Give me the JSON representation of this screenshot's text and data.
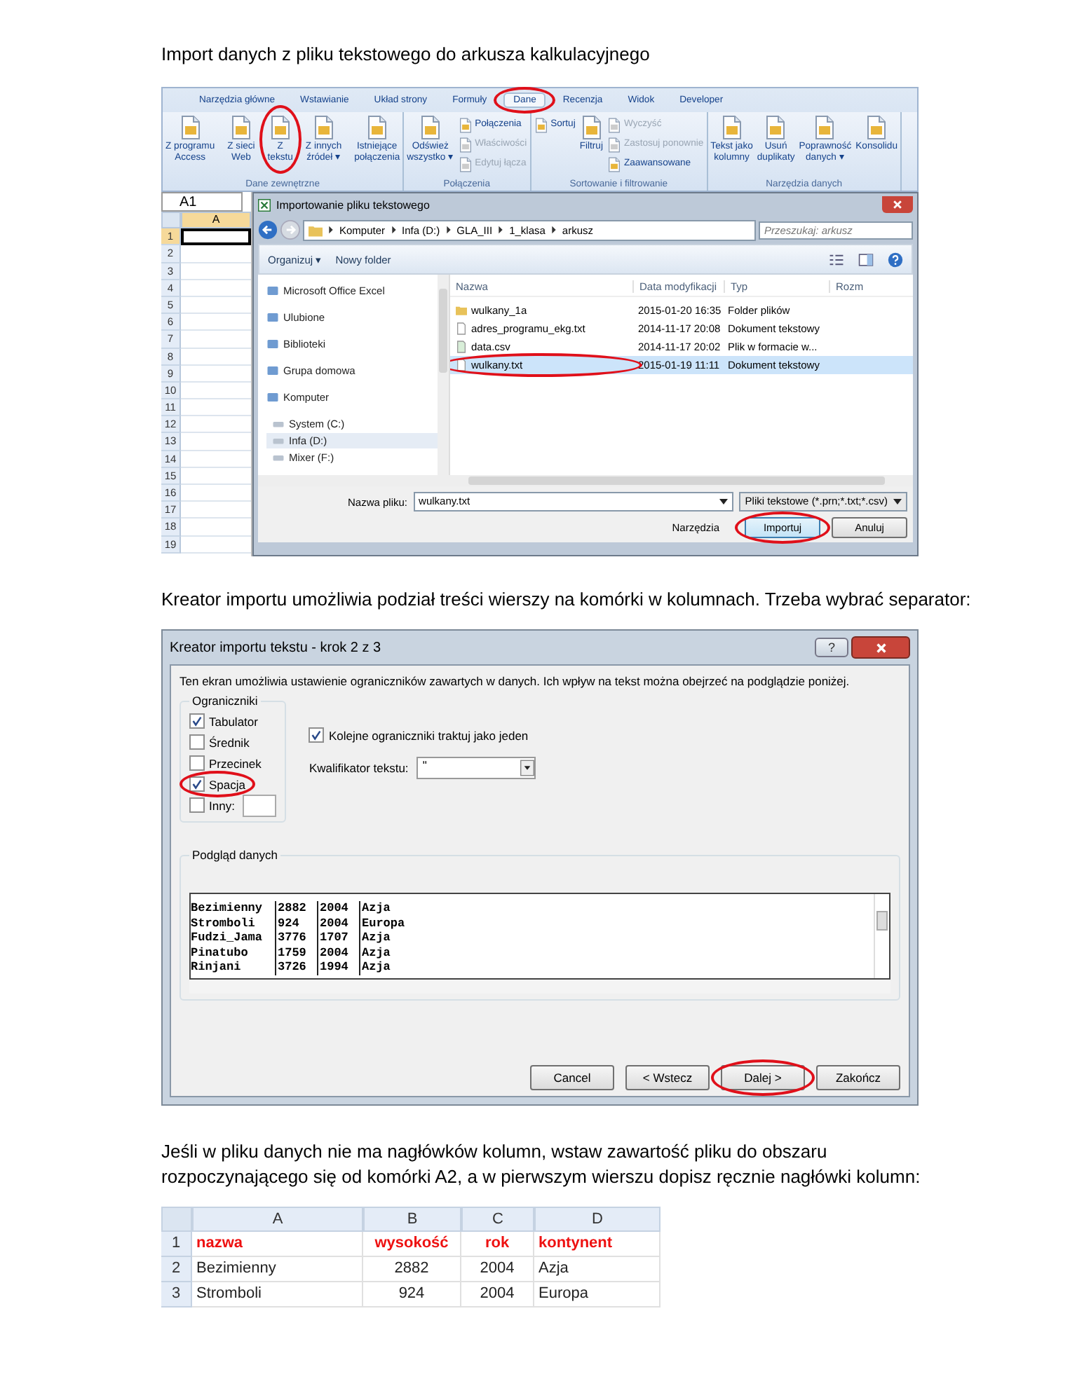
{
  "heading": "Import danych z pliku tekstowego do arkusza kalkulacyjnego",
  "excel": {
    "ribbon": {
      "tabs": [
        {
          "label": "Narzędzia główne",
          "selected": false,
          "circled": false
        },
        {
          "label": "Wstawianie",
          "selected": false,
          "circled": false
        },
        {
          "label": "Układ strony",
          "selected": false,
          "circled": false
        },
        {
          "label": "Formuły",
          "selected": false,
          "circled": false
        },
        {
          "label": "Dane",
          "selected": true,
          "circled": true
        },
        {
          "label": "Recenzja",
          "selected": false,
          "circled": false
        },
        {
          "label": "Widok",
          "selected": false,
          "circled": false
        },
        {
          "label": "Developer",
          "selected": false,
          "circled": false
        }
      ],
      "groups": [
        {
          "label": "Dane zewnętrzne",
          "items": [
            {
              "kind": "large",
              "label": "Z programu\nAccess",
              "disabled": false,
              "circled": false
            },
            {
              "kind": "large",
              "label": "Z sieci\nWeb",
              "disabled": false,
              "circled": false
            },
            {
              "kind": "large",
              "label": "Z\ntekstu",
              "disabled": false,
              "circled": true
            },
            {
              "kind": "large",
              "label": "Z innych\nźródeł ▾",
              "disabled": false,
              "circled": false
            },
            {
              "kind": "large",
              "label": "Istniejące\npołączenia",
              "disabled": false,
              "circled": false
            }
          ]
        },
        {
          "label": "Połączenia",
          "items": [
            {
              "kind": "large",
              "label": "Odśwież\nwszystko ▾",
              "disabled": false,
              "circled": false
            },
            {
              "kind": "small",
              "label": "Połączenia",
              "disabled": false,
              "circled": false
            },
            {
              "kind": "small",
              "label": "Właściwości",
              "disabled": true,
              "circled": false
            },
            {
              "kind": "small",
              "label": "Edytuj łącza",
              "disabled": true,
              "circled": false
            }
          ]
        },
        {
          "label": "Sortowanie i filtrowanie",
          "items": [
            {
              "kind": "small",
              "label": "Sortuj",
              "disabled": false,
              "circled": false
            },
            {
              "kind": "large",
              "label": "Filtruj",
              "disabled": false,
              "circled": false
            },
            {
              "kind": "small",
              "label": "Wyczyść",
              "disabled": true,
              "circled": false
            },
            {
              "kind": "small",
              "label": "Zastosuj ponownie",
              "disabled": true,
              "circled": false
            },
            {
              "kind": "small",
              "label": "Zaawansowane",
              "disabled": false,
              "circled": false
            }
          ]
        },
        {
          "label": "Narzędzia danych",
          "items": [
            {
              "kind": "large",
              "label": "Tekst jako\nkolumny",
              "disabled": false,
              "circled": false
            },
            {
              "kind": "large",
              "label": "Usuń\nduplikaty",
              "disabled": false,
              "circled": false
            },
            {
              "kind": "large",
              "label": "Poprawność\ndanych ▾",
              "disabled": false,
              "circled": false
            },
            {
              "kind": "large",
              "label": "Konsolidu",
              "disabled": false,
              "circled": false
            }
          ]
        }
      ]
    },
    "name_box": "A1",
    "column": "A",
    "rows": [
      {
        "number": "1",
        "active": true
      },
      {
        "number": "2",
        "active": false
      },
      {
        "number": "3",
        "active": false
      },
      {
        "number": "4",
        "active": false
      },
      {
        "number": "5",
        "active": false
      },
      {
        "number": "6",
        "active": false
      },
      {
        "number": "7",
        "active": false
      },
      {
        "number": "8",
        "active": false
      },
      {
        "number": "9",
        "active": false
      },
      {
        "number": "10",
        "active": false
      },
      {
        "number": "11",
        "active": false
      },
      {
        "number": "12",
        "active": false
      },
      {
        "number": "13",
        "active": false
      },
      {
        "number": "14",
        "active": false
      },
      {
        "number": "15",
        "active": false
      },
      {
        "number": "16",
        "active": false
      },
      {
        "number": "17",
        "active": false
      },
      {
        "number": "18",
        "active": false
      },
      {
        "number": "19",
        "active": false
      }
    ]
  },
  "file_dialog": {
    "title": "Importowanie pliku tekstowego",
    "path": [
      "Komputer",
      "Infa (D:)",
      "GLA_III",
      "1_klasa",
      "arkusz"
    ],
    "search_placeholder": "Przeszukaj: arkusz",
    "toolbar": [
      "Organizuj ▾",
      "Nowy folder"
    ],
    "nav": [
      {
        "label": "Microsoft Office Excel",
        "selected": false
      },
      {
        "label": "Ulubione",
        "selected": false
      },
      {
        "label": "Biblioteki",
        "selected": false
      },
      {
        "label": "Grupa domowa",
        "selected": false
      },
      {
        "label": "Komputer",
        "selected": false,
        "children": [
          {
            "label": "System (C:)",
            "selected": false
          },
          {
            "label": "Infa (D:)",
            "selected": true
          },
          {
            "label": "Mixer (F:)",
            "selected": false
          }
        ]
      }
    ],
    "columns": [
      "Nazwa",
      "Data modyfikacji",
      "Typ",
      "Rozm"
    ],
    "files": [
      {
        "kind": "folder",
        "name": "wulkany_1a",
        "date": "2015-01-20 16:35",
        "type": "Folder plików",
        "selected": false,
        "circled": false
      },
      {
        "kind": "text",
        "name": "adres_programu_ekg.txt",
        "date": "2014-11-17 20:08",
        "type": "Dokument tekstowy",
        "selected": false,
        "circled": false
      },
      {
        "kind": "csv",
        "name": "data.csv",
        "date": "2014-11-17 20:02",
        "type": "Plik w formacie w...",
        "selected": false,
        "circled": false
      },
      {
        "kind": "text",
        "name": "wulkany.txt",
        "date": "2015-01-19 11:11",
        "type": "Dokument tekstowy",
        "selected": true,
        "circled": true
      }
    ],
    "filename_label": "Nazwa pliku:",
    "filename": "wulkany.txt",
    "filter": "Pliki tekstowe (*.prn;*.txt;*.csv)",
    "tools": "Narzędzia",
    "buttons": [
      {
        "label": "Importuj",
        "circled": true
      },
      {
        "label": "Anuluj",
        "circled": false
      }
    ]
  },
  "paragraph_1": "Kreator importu umożliwia podział treści wierszy na komórki w kolumnach. Trzeba wybrać separator:",
  "wizard": {
    "title": "Kreator importu tekstu - krok 2 z 3",
    "help": "?",
    "description": "Ten ekran umożliwia ustawienie ograniczników zawartych w danych. Ich wpływ na tekst można obejrzeć na podglądzie poniżej.",
    "delimiters_label": "Ograniczniki",
    "delimiters": [
      {
        "kind": "plain",
        "label": "Tabulator",
        "checked": true,
        "circled": false
      },
      {
        "kind": "plain",
        "label": "Średnik",
        "checked": false,
        "circled": false
      },
      {
        "kind": "plain",
        "label": "Przecinek",
        "checked": false,
        "circled": false
      },
      {
        "kind": "plain",
        "label": "Spacja",
        "checked": true,
        "circled": true
      },
      {
        "kind": "field",
        "label": "Inny:",
        "checked": false,
        "circled": false
      }
    ],
    "consecutive": {
      "label": "Kolejne ograniczniki traktuj jako jeden",
      "checked": true
    },
    "qualifier": {
      "label": "Kwalifikator tekstu:",
      "value": "\""
    },
    "preview_label": "Podgląd danych",
    "preview_rows": [
      [
        "Bezimienny",
        "2882",
        "2004",
        "Azja"
      ],
      [
        "Stromboli",
        "924",
        "2004",
        "Europa"
      ],
      [
        "Fudzi_Jama",
        "3776",
        "1707",
        "Azja"
      ],
      [
        "Pinatubo",
        "1759",
        "2004",
        "Azja"
      ],
      [
        "Rinjani",
        "3726",
        "1994",
        "Azja"
      ]
    ],
    "buttons": [
      {
        "label": "Cancel",
        "circled": false
      },
      {
        "label": "< Wstecz",
        "circled": false
      },
      {
        "label": "Dalej >",
        "circled": true
      },
      {
        "label": "Zakończ",
        "circled": false
      }
    ]
  },
  "paragraph_2": "Jeśli w pliku danych nie ma nagłówków kolumn, wstaw zawartość pliku do obszaru rozpoczynającego się od komórki A2, a w pierwszym wierszu dopisz ręcznie nagłówki kolumn:",
  "result_table": {
    "columns": [
      "A",
      "B",
      "C",
      "D"
    ],
    "rows": [
      {
        "number": "1",
        "kind": "header",
        "cells": [
          "nazwa",
          "wysokość",
          "rok",
          "kontynent"
        ]
      },
      {
        "number": "2",
        "kind": "data",
        "cells": [
          "Bezimienny",
          "2882",
          "2004",
          "Azja"
        ]
      },
      {
        "number": "3",
        "kind": "data",
        "cells": [
          "Stromboli",
          "924",
          "2004",
          "Europa"
        ]
      }
    ]
  }
}
